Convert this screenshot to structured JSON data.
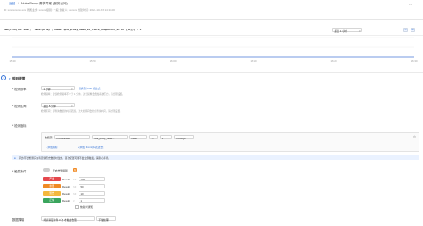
{
  "header": {
    "crumb_root": "返回",
    "crumb_title": "Nuke Proxy 请求异常 (服务出问)",
    "crumb_extra": "(服务出问)",
    "meta_text": "ID: xxxxxxxxxx-xxx   所属业务: xxxxx   级别: 一般   负责人: xxxxxx   创建时间: 2024-10-XX 14:11:00"
  },
  "query": {
    "expression": "sum(rate(le=\"sum\", \"nuke-proxy\", name=\"qca_proxy_nuke_ex_route_endpoints_error\"[1m])) > 1",
    "time_range": "最近 1 小时",
    "refresh_icon": "refresh-icon",
    "settings_icon": "gear-icon"
  },
  "chart_data": {
    "type": "line",
    "x": [
      "15:40",
      "15:50",
      "16:00",
      "16:10",
      "16:20",
      "16:30"
    ],
    "series": [
      {
        "values": [
          0,
          0,
          0,
          0,
          0,
          0
        ]
      }
    ],
    "y_ticks": [
      "1",
      "0.5",
      "0"
    ],
    "grid": true
  },
  "section": {
    "title": "规则配置",
    "info_icon": "info-icon"
  },
  "form": {
    "freq_label": "* 检测频率",
    "freq_value": "1 分钟",
    "freq_link": "切换到 Cron 表达式",
    "freq_hint": "检测频率：建议检测频率不少于 1 分钟，过于频繁会增加系统压力，请合理设置。",
    "window_label": "* 检测区间",
    "window_value": "最近 5 分钟",
    "window_hint": "检测区间：即查询数据的时间范围，过大的区间会拉长查询时间，请合理设置。",
    "metric_label": "* 检测指标",
    "metric_row": {
      "datasource_label": "数据源",
      "datasource_value": "Prometheus",
      "metric_value": "qca_proxy_nuke...",
      "func_value": "Last",
      "op_value": ">=",
      "threshold_value": "1",
      "unit_value": "PromQL"
    },
    "metric_add_link": "+ 添加指标",
    "metric_add_expr_link": "+ 添加 PromQL 表达式",
    "notice_text": "同比/环比检测只在有足够历史数据时生效，首次配置可能不会立即触发，请耐心等待。",
    "trigger_label": "* 触发条件",
    "trigger_toggle_text": "开启告警级别",
    "trigger_toggle_badge": "新",
    "levels": [
      {
        "name": "严重",
        "color": "#e5484d",
        "field": "Result",
        "op": ">=",
        "value": "100"
      },
      {
        "name": "重要",
        "color": "#f08a24",
        "field": "Result",
        "op": ">=",
        "value": "50"
      },
      {
        "name": "警告",
        "color": "#f5b83d",
        "field": "Result",
        "op": ">=",
        "value": "10"
      },
      {
        "name": "正常",
        "color": "#3aa55d",
        "field": "Result",
        "op": "<",
        "value": "1"
      }
    ],
    "recovery_check_text": "恢复时通知",
    "noise_label": "数据降噪",
    "noise_value": "持续满足条件 3 次 才触发告警",
    "noise_select": "不做处理"
  }
}
